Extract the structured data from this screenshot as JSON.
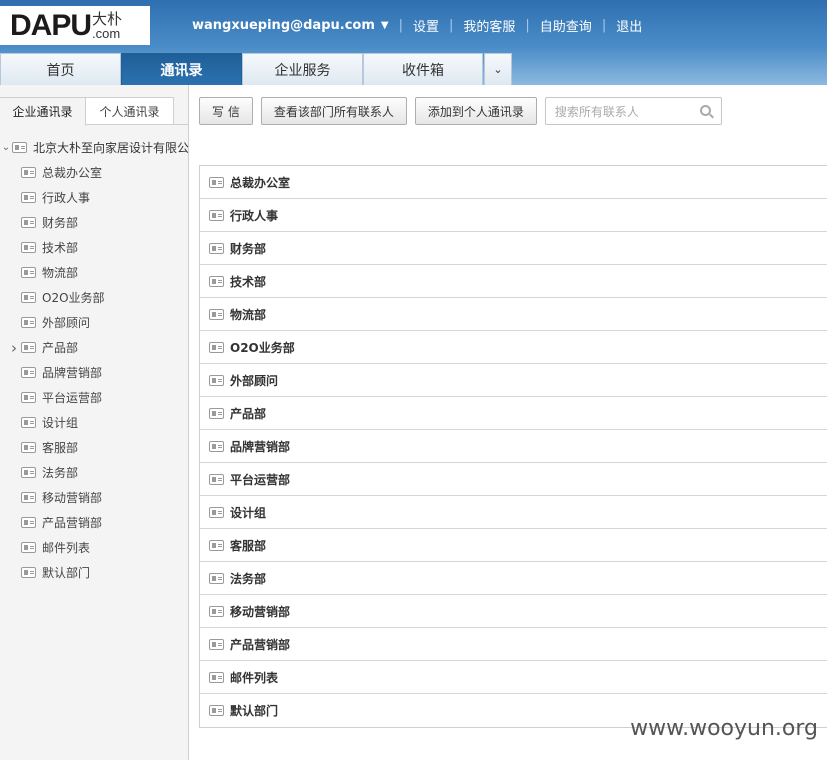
{
  "header": {
    "logo": {
      "main": "DAPU",
      "cn": "大朴",
      "com": ".com"
    },
    "user_email": "wangxueping@dapu.com",
    "links": [
      "设置",
      "我的客服",
      "自助查询",
      "退出"
    ]
  },
  "tabs": [
    {
      "label": "首页",
      "active": false
    },
    {
      "label": "通讯录",
      "active": true
    },
    {
      "label": "企业服务",
      "active": false
    },
    {
      "label": "收件箱",
      "active": false
    }
  ],
  "sidebar": {
    "tabs": [
      "企业通讯录",
      "个人通讯录"
    ],
    "root": "北京大朴至向家居设计有限公司",
    "items": [
      {
        "label": "总裁办公室",
        "expandable": false
      },
      {
        "label": "行政人事",
        "expandable": false
      },
      {
        "label": "财务部",
        "expandable": false
      },
      {
        "label": "技术部",
        "expandable": false
      },
      {
        "label": "物流部",
        "expandable": false
      },
      {
        "label": "O2O业务部",
        "expandable": false
      },
      {
        "label": "外部顾问",
        "expandable": false
      },
      {
        "label": "产品部",
        "expandable": true
      },
      {
        "label": "品牌营销部",
        "expandable": false
      },
      {
        "label": "平台运营部",
        "expandable": false
      },
      {
        "label": "设计组",
        "expandable": false
      },
      {
        "label": "客服部",
        "expandable": false
      },
      {
        "label": "法务部",
        "expandable": false
      },
      {
        "label": "移动营销部",
        "expandable": false
      },
      {
        "label": "产品营销部",
        "expandable": false
      },
      {
        "label": "邮件列表",
        "expandable": false
      },
      {
        "label": "默认部门",
        "expandable": false
      }
    ]
  },
  "toolbar": {
    "write": "写 信",
    "view_all": "查看该部门所有联系人",
    "add_personal": "添加到个人通讯录",
    "search_placeholder": "搜索所有联系人"
  },
  "departments": [
    "总裁办公室",
    "行政人事",
    "财务部",
    "技术部",
    "物流部",
    "O2O业务部",
    "外部顾问",
    "产品部",
    "品牌营销部",
    "平台运营部",
    "设计组",
    "客服部",
    "法务部",
    "移动营销部",
    "产品营销部",
    "邮件列表",
    "默认部门"
  ],
  "watermark": "www.wooyun.org"
}
